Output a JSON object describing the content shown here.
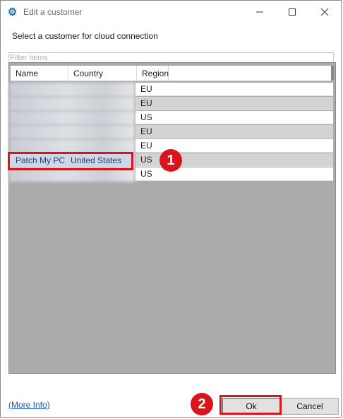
{
  "window": {
    "title": "Edit a customer",
    "app_icon": "gear-icon",
    "controls": [
      "minimize-icon",
      "maximize-icon",
      "close-icon"
    ]
  },
  "prompt": "Select a customer for cloud connection",
  "filter": {
    "placeholder": "Filter items",
    "value": ""
  },
  "table": {
    "columns": [
      "Name",
      "Country",
      "Region"
    ],
    "rows": [
      {
        "name": "",
        "country": "",
        "region": "EU",
        "blurred": true
      },
      {
        "name": "",
        "country": "",
        "region": "EU",
        "blurred": true
      },
      {
        "name": "",
        "country": "",
        "region": "US",
        "blurred": true
      },
      {
        "name": "",
        "country": "",
        "region": "EU",
        "blurred": true
      },
      {
        "name": "",
        "country": "",
        "region": "EU",
        "blurred": true
      },
      {
        "name": "Patch My PC",
        "country": "United States",
        "region": "US",
        "selected": true
      },
      {
        "name": "",
        "country": "",
        "region": "US",
        "blurred": true
      }
    ]
  },
  "annotations": {
    "step1": "1",
    "step2": "2",
    "color": "#d9151c"
  },
  "footer": {
    "more_info": "(More Info)",
    "ok": "Ok",
    "cancel": "Cancel"
  }
}
